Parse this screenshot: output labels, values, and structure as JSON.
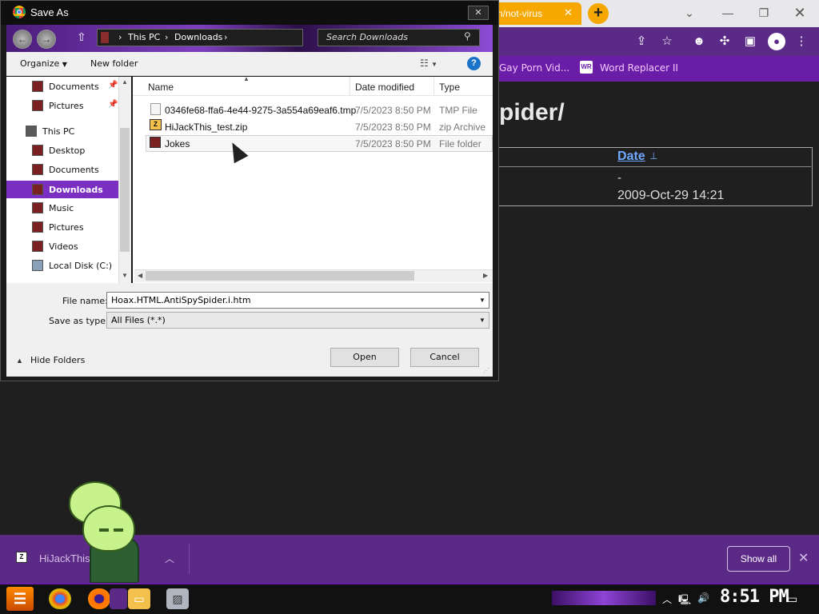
{
  "browser": {
    "tab_title": "n/not-virus",
    "bookmarks": [
      "Gay Porn Vid...",
      "Word Replacer II"
    ],
    "bookmark_icon_text": "WR",
    "page_heading": "pider/",
    "table": {
      "date_header": "Date",
      "row1_date": "-",
      "row2_date": "2009-Oct-29 14:21"
    }
  },
  "download_bar": {
    "file_name": "HiJackThis_test.zip",
    "show_all_label": "Show all"
  },
  "taskbar": {
    "clock": "8:51 PM"
  },
  "dialog": {
    "title": "Save As",
    "breadcrumbs": [
      "This PC",
      "Downloads"
    ],
    "search_placeholder": "Search Downloads",
    "organize_label": "Organize",
    "new_folder_label": "New folder",
    "nav_items": [
      {
        "label": "Documents",
        "pinned": true
      },
      {
        "label": "Pictures",
        "pinned": true
      },
      {
        "label": "This PC"
      },
      {
        "label": "Desktop"
      },
      {
        "label": "Documents"
      },
      {
        "label": "Downloads",
        "selected": true
      },
      {
        "label": "Music"
      },
      {
        "label": "Pictures"
      },
      {
        "label": "Videos"
      },
      {
        "label": "Local Disk (C:)"
      }
    ],
    "columns": [
      "Name",
      "Date modified",
      "Type"
    ],
    "files": [
      {
        "name": "0346fe68-ffa6-4e44-9275-3a554a69eaf6.tmp",
        "date": "7/5/2023 8:50 PM",
        "type": "TMP File"
      },
      {
        "name": "HiJackThis_test.zip",
        "date": "7/5/2023 8:50 PM",
        "type": "zip Archive"
      },
      {
        "name": "Jokes",
        "date": "7/5/2023 8:50 PM",
        "type": "File folder"
      }
    ],
    "file_name_label": "File name:",
    "file_name_value": "Hoax.HTML.AntiSpySpider.i.htm",
    "save_type_label": "Save as type:",
    "save_type_value": "All Files (*.*)",
    "open_label": "Open",
    "cancel_label": "Cancel",
    "hide_folders_label": "Hide Folders"
  }
}
